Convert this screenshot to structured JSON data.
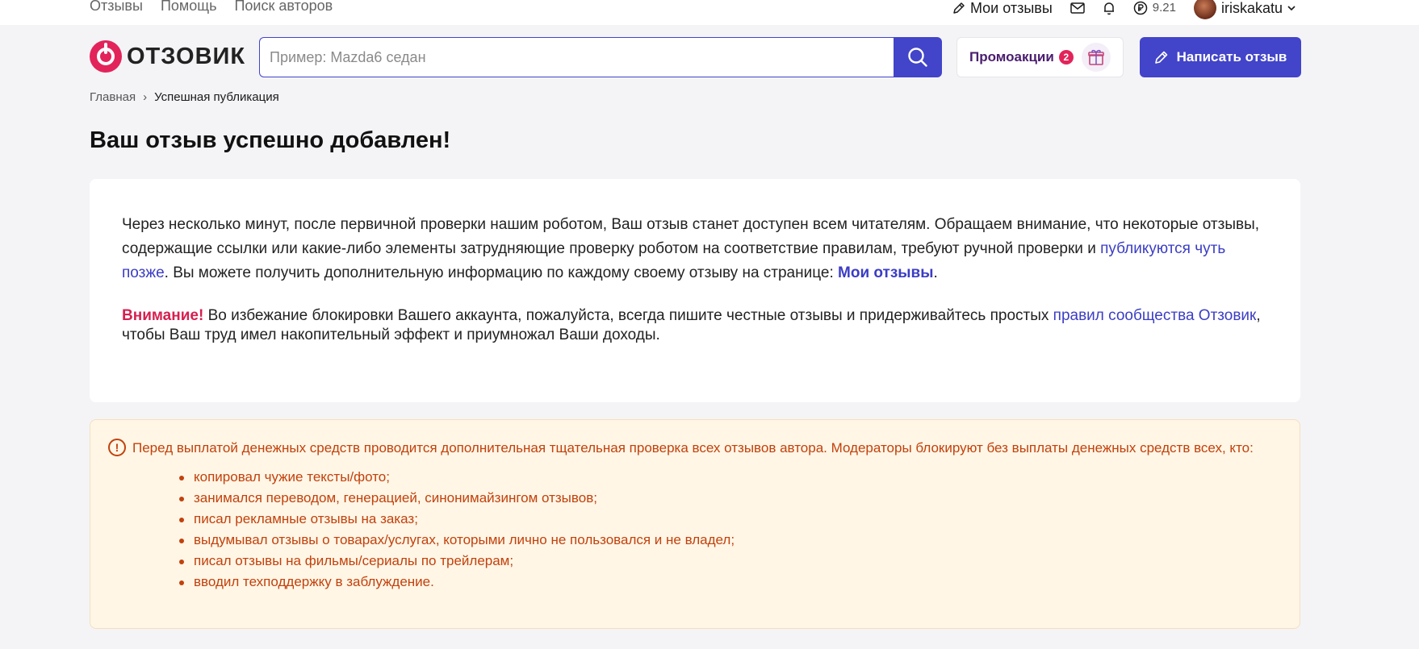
{
  "topnav": {
    "items": [
      "Отзывы",
      "Помощь",
      "Поиск авторов"
    ],
    "my_reviews": "Мои отзывы",
    "balance": "9.21",
    "username": "iriskakatu"
  },
  "header": {
    "logo_text": "ОТЗОВИК",
    "search_placeholder": "Пример: Mazda6 седан",
    "promo_label": "Промоакции",
    "promo_count": "2",
    "write_button": "Написать отзыв"
  },
  "breadcrumb": {
    "home": "Главная",
    "separator": "›",
    "current": "Успешная публикация"
  },
  "page_title": "Ваш отзыв успешно добавлен!",
  "card": {
    "p1_a": "Через несколько минут, после первичной проверки нашим роботом, Ваш отзыв станет доступен всем читателям. Обращаем внимание, что некоторые отзывы, содержащие ссылки или какие-либо элементы затрудняющие проверку роботом на соответствие правилам, требуют ручной проверки и ",
    "p1_link": "публикуются чуть позже",
    "p1_b": ". Вы можете получить дополнительную информацию по каждому своему отзыву на странице: ",
    "p1_link2": "Мои отзывы",
    "p1_c": ".",
    "attention": "Внимание!",
    "p2_a": " Во избежание блокировки Вашего аккаунта, пожалуйста, всегда пишите честные отзывы и придерживайтесь простых ",
    "p2_link": "правил сообщества Отзовик",
    "p2_b": ", чтобы Ваш труд имел накопительный эффект и приумножал Ваши доходы."
  },
  "notice": {
    "icon": "!",
    "text": "Перед выплатой денежных средств проводится дополнительная тщательная проверка всех отзывов автора. Модераторы блокируют без выплаты денежных средств всех, кто:",
    "items": [
      "копировал чужие тексты/фото;",
      "занимался переводом, генерацией, синонимайзингом отзывов;",
      "писал рекламные отзывы на заказ;",
      "выдумывал отзывы о товарах/услугах, которыми лично не пользовался и не владел;",
      "писал отзывы на фильмы/сериалы по трейлерам;",
      "вводил техподдержку в заблуждение."
    ]
  },
  "colors": {
    "accent": "#4244c9",
    "brand": "#e2245a",
    "warning_text": "#c2410c",
    "warning_bg": "#fff6e6"
  }
}
